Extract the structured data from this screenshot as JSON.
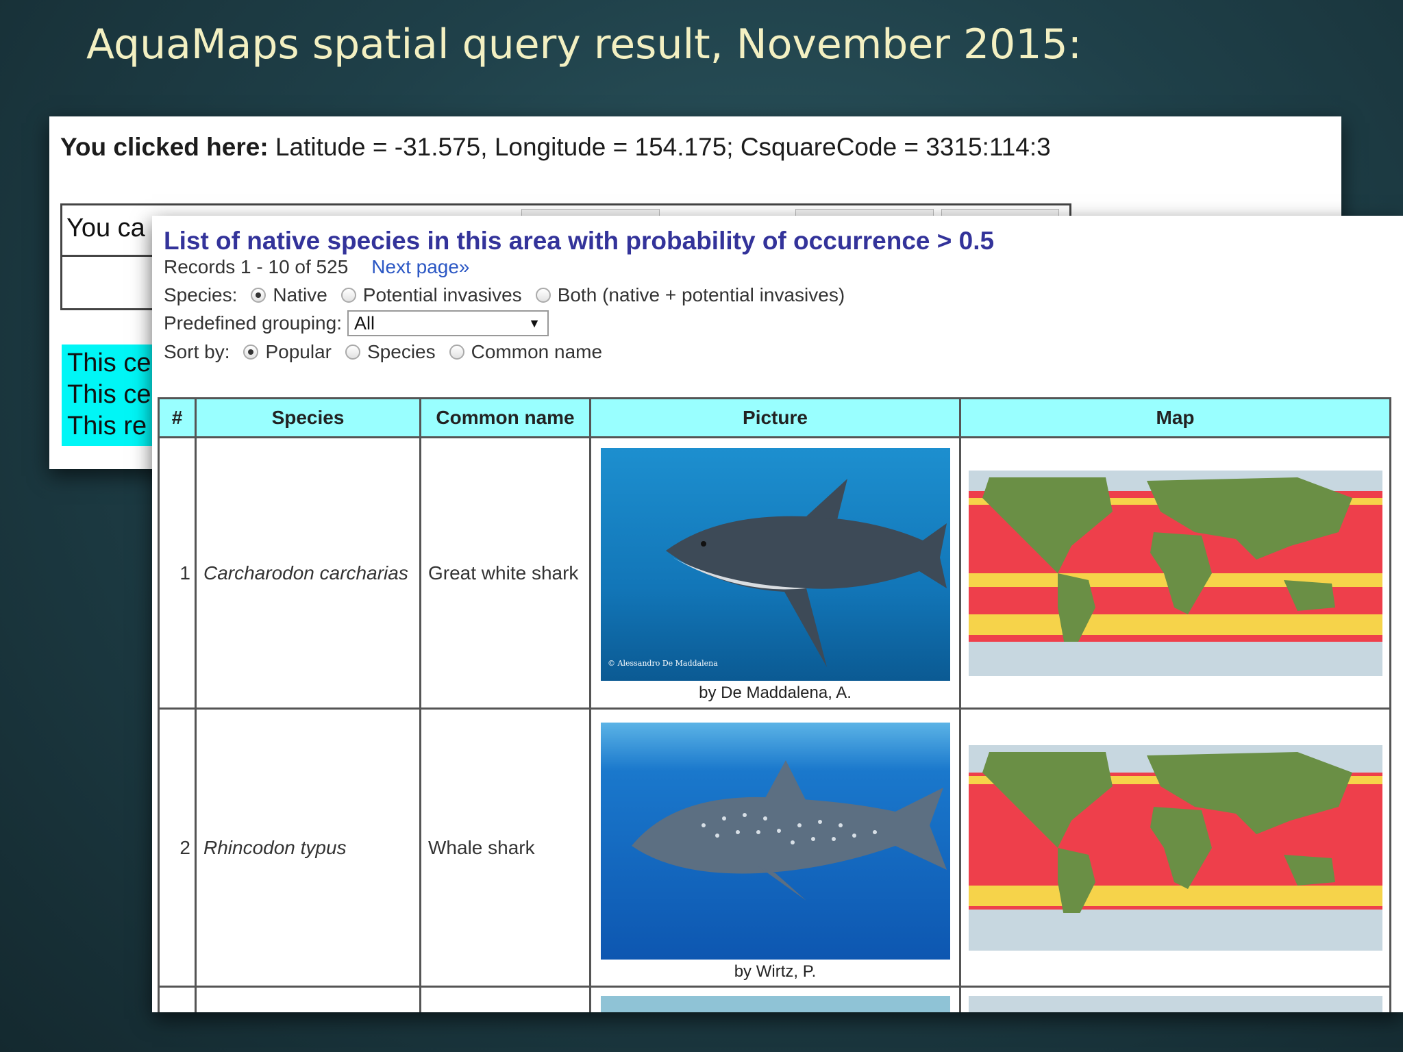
{
  "slide_title": "AquaMaps spatial query result, November 2015:",
  "back_window": {
    "clicked_label": "You clicked here:",
    "clicked_details": " Latitude = -31.575, Longitude = 154.175; CsquareCode = 3315:114:3",
    "table_partial_text": "You ca",
    "cyan_lines": [
      "This ce",
      "This ce",
      "This re"
    ]
  },
  "front_window": {
    "list_title": "List of native species in this area with probability of occurrence > 0.5",
    "records_text": "Records 1 - 10 of  525",
    "next_page": "Next page»",
    "species_label": "Species:",
    "species_options": [
      "Native",
      "Potential invasives",
      "Both (native + potential invasives)"
    ],
    "species_selected": "Native",
    "grouping_label": "Predefined grouping:",
    "grouping_value": "All",
    "sort_label": "Sort by:",
    "sort_options": [
      "Popular",
      "Species",
      "Common name"
    ],
    "sort_selected": "Popular",
    "columns": [
      "#",
      "Species",
      "Common name",
      "Picture",
      "Map"
    ],
    "rows": [
      {
        "num": "1",
        "species": "Carcharodon carcharias",
        "common": "Great white shark",
        "credit": "by De Maddalena, A.",
        "photo_watermark": "© Alessandro De Maddalena"
      },
      {
        "num": "2",
        "species": "Rhincodon typus",
        "common": "Whale shark",
        "credit": "by Wirtz, P."
      }
    ]
  },
  "colors": {
    "header_cyan": "#99ffff",
    "title_blue": "#33339a",
    "link_blue": "#2b57c4",
    "cyan_block": "#00f6f6",
    "slide_title": "#f3f0c2"
  }
}
